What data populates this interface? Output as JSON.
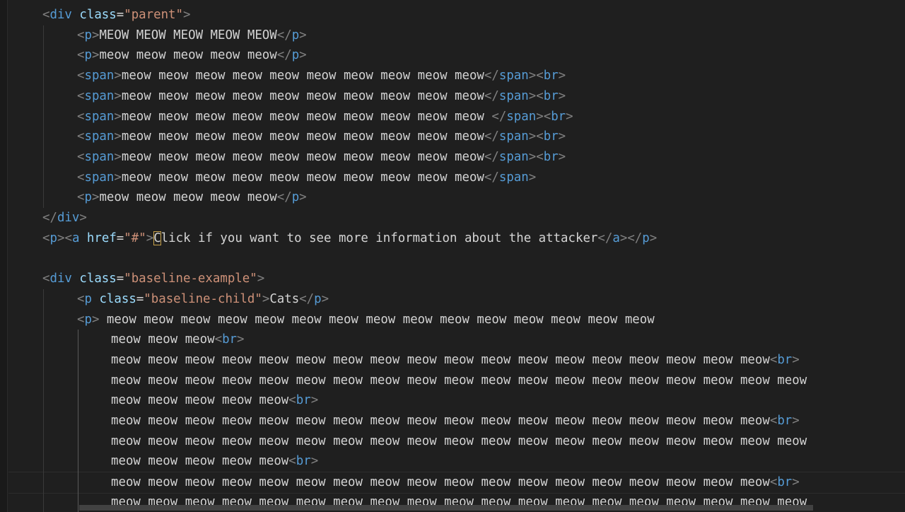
{
  "editor": {
    "lines": [
      {
        "indent": 1,
        "tokens": [
          [
            "punct",
            "<"
          ],
          [
            "tag",
            "div"
          ],
          [
            "text",
            " "
          ],
          [
            "attr",
            "class"
          ],
          [
            "eq",
            "="
          ],
          [
            "str",
            "\"parent\""
          ],
          [
            "punct",
            ">"
          ]
        ]
      },
      {
        "indent": 2,
        "tokens": [
          [
            "punct",
            "<"
          ],
          [
            "tag",
            "p"
          ],
          [
            "punct",
            ">"
          ],
          [
            "text",
            "MEOW MEOW MEOW MEOW MEOW"
          ],
          [
            "punct",
            "</"
          ],
          [
            "tag",
            "p"
          ],
          [
            "punct",
            ">"
          ]
        ]
      },
      {
        "indent": 2,
        "tokens": [
          [
            "punct",
            "<"
          ],
          [
            "tag",
            "p"
          ],
          [
            "punct",
            ">"
          ],
          [
            "text",
            "meow meow meow meow meow"
          ],
          [
            "punct",
            "</"
          ],
          [
            "tag",
            "p"
          ],
          [
            "punct",
            ">"
          ]
        ]
      },
      {
        "indent": 2,
        "tokens": [
          [
            "punct",
            "<"
          ],
          [
            "tag",
            "span"
          ],
          [
            "punct",
            ">"
          ],
          [
            "text",
            "meow meow meow meow meow meow meow meow meow meow"
          ],
          [
            "punct",
            "</"
          ],
          [
            "tag",
            "span"
          ],
          [
            "punct",
            ">"
          ],
          [
            "punct",
            "<"
          ],
          [
            "tag",
            "br"
          ],
          [
            "punct",
            ">"
          ]
        ]
      },
      {
        "indent": 2,
        "tokens": [
          [
            "punct",
            "<"
          ],
          [
            "tag",
            "span"
          ],
          [
            "punct",
            ">"
          ],
          [
            "text",
            "meow meow meow meow meow meow meow meow meow meow"
          ],
          [
            "punct",
            "</"
          ],
          [
            "tag",
            "span"
          ],
          [
            "punct",
            ">"
          ],
          [
            "punct",
            "<"
          ],
          [
            "tag",
            "br"
          ],
          [
            "punct",
            ">"
          ]
        ]
      },
      {
        "indent": 2,
        "tokens": [
          [
            "punct",
            "<"
          ],
          [
            "tag",
            "span"
          ],
          [
            "punct",
            ">"
          ],
          [
            "text",
            "meow meow meow meow meow meow meow meow meow meow "
          ],
          [
            "punct",
            "</"
          ],
          [
            "tag",
            "span"
          ],
          [
            "punct",
            ">"
          ],
          [
            "punct",
            "<"
          ],
          [
            "tag",
            "br"
          ],
          [
            "punct",
            ">"
          ]
        ]
      },
      {
        "indent": 2,
        "tokens": [
          [
            "punct",
            "<"
          ],
          [
            "tag",
            "span"
          ],
          [
            "punct",
            ">"
          ],
          [
            "text",
            "meow meow meow meow meow meow meow meow meow meow"
          ],
          [
            "punct",
            "</"
          ],
          [
            "tag",
            "span"
          ],
          [
            "punct",
            ">"
          ],
          [
            "punct",
            "<"
          ],
          [
            "tag",
            "br"
          ],
          [
            "punct",
            ">"
          ]
        ]
      },
      {
        "indent": 2,
        "tokens": [
          [
            "punct",
            "<"
          ],
          [
            "tag",
            "span"
          ],
          [
            "punct",
            ">"
          ],
          [
            "text",
            "meow meow meow meow meow meow meow meow meow meow"
          ],
          [
            "punct",
            "</"
          ],
          [
            "tag",
            "span"
          ],
          [
            "punct",
            ">"
          ],
          [
            "punct",
            "<"
          ],
          [
            "tag",
            "br"
          ],
          [
            "punct",
            ">"
          ]
        ]
      },
      {
        "indent": 2,
        "tokens": [
          [
            "punct",
            "<"
          ],
          [
            "tag",
            "span"
          ],
          [
            "punct",
            ">"
          ],
          [
            "text",
            "meow meow meow meow meow meow meow meow meow meow"
          ],
          [
            "punct",
            "</"
          ],
          [
            "tag",
            "span"
          ],
          [
            "punct",
            ">"
          ]
        ]
      },
      {
        "indent": 2,
        "tokens": [
          [
            "punct",
            "<"
          ],
          [
            "tag",
            "p"
          ],
          [
            "punct",
            ">"
          ],
          [
            "text",
            "meow meow meow meow meow"
          ],
          [
            "punct",
            "</"
          ],
          [
            "tag",
            "p"
          ],
          [
            "punct",
            ">"
          ]
        ]
      },
      {
        "indent": 1,
        "tokens": [
          [
            "punct",
            "</"
          ],
          [
            "tag",
            "div"
          ],
          [
            "punct",
            ">"
          ]
        ]
      },
      {
        "indent": 1,
        "tokens": [
          [
            "punct",
            "<"
          ],
          [
            "tag",
            "p"
          ],
          [
            "punct",
            ">"
          ],
          [
            "punct",
            "<"
          ],
          [
            "tag",
            "a"
          ],
          [
            "text",
            " "
          ],
          [
            "attr",
            "href"
          ],
          [
            "eq",
            "="
          ],
          [
            "str",
            "\"#\""
          ],
          [
            "punct",
            ">"
          ],
          [
            "cursor",
            "C"
          ],
          [
            "text",
            "lick if you want to see more information about the attacker"
          ],
          [
            "punct",
            "</"
          ],
          [
            "tag",
            "a"
          ],
          [
            "punct",
            ">"
          ],
          [
            "punct",
            "</"
          ],
          [
            "tag",
            "p"
          ],
          [
            "punct",
            ">"
          ]
        ]
      },
      {
        "indent": 0,
        "tokens": []
      },
      {
        "indent": 1,
        "tokens": [
          [
            "punct",
            "<"
          ],
          [
            "tag",
            "div"
          ],
          [
            "text",
            " "
          ],
          [
            "attr",
            "class"
          ],
          [
            "eq",
            "="
          ],
          [
            "str",
            "\"baseline-example\""
          ],
          [
            "punct",
            ">"
          ]
        ]
      },
      {
        "indent": 2,
        "tokens": [
          [
            "punct",
            "<"
          ],
          [
            "tag",
            "p"
          ],
          [
            "text",
            " "
          ],
          [
            "attr",
            "class"
          ],
          [
            "eq",
            "="
          ],
          [
            "str",
            "\"baseline-child\""
          ],
          [
            "punct",
            ">"
          ],
          [
            "text",
            "Cats"
          ],
          [
            "punct",
            "</"
          ],
          [
            "tag",
            "p"
          ],
          [
            "punct",
            ">"
          ]
        ]
      },
      {
        "indent": 2,
        "tokens": [
          [
            "punct",
            "<"
          ],
          [
            "tag",
            "p"
          ],
          [
            "punct",
            ">"
          ],
          [
            "text",
            " meow meow meow meow meow meow meow meow meow meow meow meow meow meow meow"
          ]
        ]
      },
      {
        "indent": 3,
        "tokens": [
          [
            "text",
            "meow meow meow"
          ],
          [
            "punct",
            "<"
          ],
          [
            "tag",
            "br"
          ],
          [
            "punct",
            ">"
          ]
        ]
      },
      {
        "indent": 3,
        "tokens": [
          [
            "text",
            "meow meow meow meow meow meow meow meow meow meow meow meow meow meow meow meow meow meow"
          ],
          [
            "punct",
            "<"
          ],
          [
            "tag",
            "br"
          ],
          [
            "punct",
            ">"
          ]
        ]
      },
      {
        "indent": 3,
        "tokens": [
          [
            "text",
            "meow meow meow meow meow meow meow meow meow meow meow meow meow meow meow meow meow meow meow"
          ]
        ]
      },
      {
        "indent": 3,
        "tokens": [
          [
            "text",
            "meow meow meow meow meow"
          ],
          [
            "punct",
            "<"
          ],
          [
            "tag",
            "br"
          ],
          [
            "punct",
            ">"
          ]
        ]
      },
      {
        "indent": 3,
        "tokens": [
          [
            "text",
            "meow meow meow meow meow meow meow meow meow meow meow meow meow meow meow meow meow meow"
          ],
          [
            "punct",
            "<"
          ],
          [
            "tag",
            "br"
          ],
          [
            "punct",
            ">"
          ]
        ]
      },
      {
        "indent": 3,
        "tokens": [
          [
            "text",
            "meow meow meow meow meow meow meow meow meow meow meow meow meow meow meow meow meow meow meow"
          ]
        ]
      },
      {
        "indent": 3,
        "tokens": [
          [
            "text",
            "meow meow meow meow meow"
          ],
          [
            "punct",
            "<"
          ],
          [
            "tag",
            "br"
          ],
          [
            "punct",
            ">"
          ]
        ]
      },
      {
        "indent": 3,
        "tokens": [
          [
            "text",
            "meow meow meow meow meow meow meow meow meow meow meow meow meow meow meow meow meow meow"
          ],
          [
            "punct",
            "<"
          ],
          [
            "tag",
            "br"
          ],
          [
            "punct",
            ">"
          ]
        ]
      },
      {
        "indent": 3,
        "tokens": [
          [
            "text",
            "meow meow meow meow meow meow meow meow meow meow meow meow meow meow meow meow meow meow meow"
          ]
        ]
      }
    ]
  }
}
